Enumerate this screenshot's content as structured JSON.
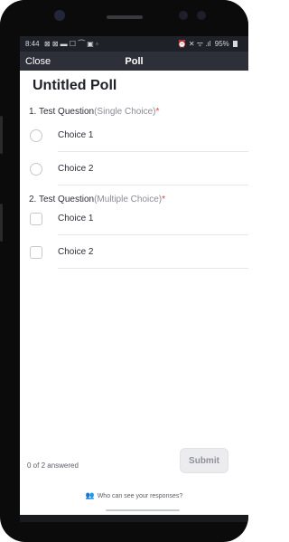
{
  "status": {
    "time": "8:44",
    "left_icons": "⊠ ⊠ ▬ ☐ ⏜ ▣ ◦",
    "right_icons": "⏰ ✕ ᯤ .ıl",
    "battery": "95%"
  },
  "nav": {
    "close_label": "Close",
    "title": "Poll"
  },
  "poll": {
    "title": "Untitled Poll",
    "questions": [
      {
        "number": "1. ",
        "text": "Test Question",
        "kind": "(Single Choice)",
        "required": "*",
        "choices": [
          "Choice 1",
          "Choice 2"
        ]
      },
      {
        "number": "2. ",
        "text": "Test Question",
        "kind": "(Multiple Choice)",
        "required": "*",
        "choices": [
          "Choice 1",
          "Choice 2"
        ]
      }
    ]
  },
  "footer": {
    "answered": "0 of 2 answered",
    "submit_label": "Submit",
    "who_label": "Who can see your responses?"
  },
  "colors": {
    "navbar": "#2d2f39",
    "required": "#e0413a",
    "link_icon": "#4b78d6"
  }
}
